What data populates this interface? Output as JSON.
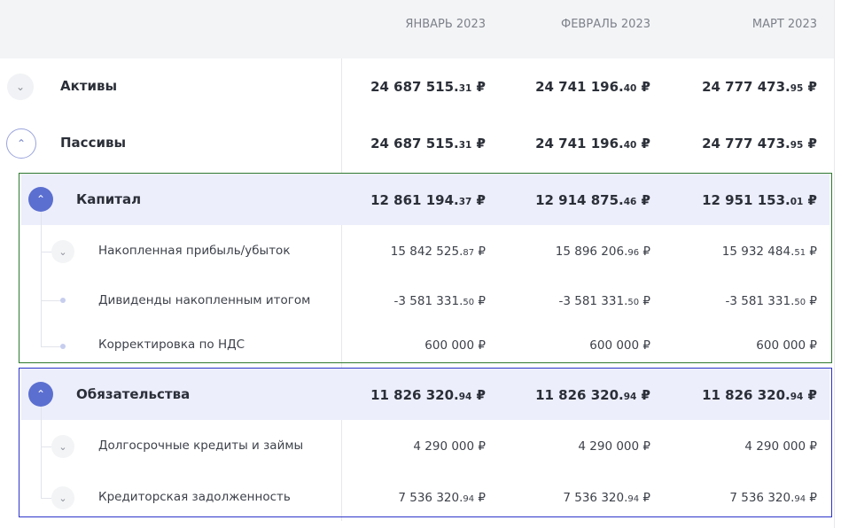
{
  "columns": [
    "ЯНВАРЬ 2023",
    "ФЕВРАЛЬ 2023",
    "МАРТ 2023"
  ],
  "rows": [
    {
      "label": "Активы",
      "values": [
        {
          "int": "24 687 515.",
          "frac": "31",
          "cur": " ₽"
        },
        {
          "int": "24 741 196.",
          "frac": "40",
          "cur": " ₽"
        },
        {
          "int": "24 777 473.",
          "frac": "95",
          "cur": " ₽"
        }
      ]
    },
    {
      "label": "Пассивы",
      "values": [
        {
          "int": "24 687 515.",
          "frac": "31",
          "cur": " ₽"
        },
        {
          "int": "24 741 196.",
          "frac": "40",
          "cur": " ₽"
        },
        {
          "int": "24 777 473.",
          "frac": "95",
          "cur": " ₽"
        }
      ]
    },
    {
      "label": "Капитал",
      "values": [
        {
          "int": "12 861 194.",
          "frac": "37",
          "cur": " ₽"
        },
        {
          "int": "12 914 875.",
          "frac": "46",
          "cur": " ₽"
        },
        {
          "int": "12 951 153.",
          "frac": "01",
          "cur": " ₽"
        }
      ]
    },
    {
      "label": "Накопленная прибыль/убыток",
      "values": [
        {
          "int": "15 842 525.",
          "frac": "87",
          "cur": " ₽"
        },
        {
          "int": "15 896 206.",
          "frac": "96",
          "cur": " ₽"
        },
        {
          "int": "15 932 484.",
          "frac": "51",
          "cur": " ₽"
        }
      ]
    },
    {
      "label": "Дивиденды накопленным итогом",
      "values": [
        {
          "int": "-3 581 331.",
          "frac": "50",
          "cur": " ₽"
        },
        {
          "int": "-3 581 331.",
          "frac": "50",
          "cur": " ₽"
        },
        {
          "int": "-3 581 331.",
          "frac": "50",
          "cur": " ₽"
        }
      ]
    },
    {
      "label": "Корректировка по НДС",
      "values": [
        {
          "int": "600 000",
          "frac": "",
          "cur": " ₽"
        },
        {
          "int": "600 000",
          "frac": "",
          "cur": " ₽"
        },
        {
          "int": "600 000",
          "frac": "",
          "cur": " ₽"
        }
      ]
    },
    {
      "label": "Обязательства",
      "values": [
        {
          "int": "11 826 320.",
          "frac": "94",
          "cur": " ₽"
        },
        {
          "int": "11 826 320.",
          "frac": "94",
          "cur": " ₽"
        },
        {
          "int": "11 826 320.",
          "frac": "94",
          "cur": " ₽"
        }
      ]
    },
    {
      "label": "Долгосрочные кредиты и займы",
      "values": [
        {
          "int": "4 290 000",
          "frac": "",
          "cur": " ₽"
        },
        {
          "int": "4 290 000",
          "frac": "",
          "cur": " ₽"
        },
        {
          "int": "4 290 000",
          "frac": "",
          "cur": " ₽"
        }
      ]
    },
    {
      "label": "Кредиторская задолженность",
      "values": [
        {
          "int": "7 536 320.",
          "frac": "94",
          "cur": " ₽"
        },
        {
          "int": "7 536 320.",
          "frac": "94",
          "cur": " ₽"
        },
        {
          "int": "7 536 320.",
          "frac": "94",
          "cur": " ₽"
        }
      ]
    }
  ],
  "icons": {
    "collapsed": "chevron-down-icon",
    "expanded": "chevron-up-icon",
    "leaf": "dot-icon"
  },
  "colors": {
    "accent": "#5b6fd0",
    "highlight": "#eceefb",
    "green_outline": "#2f7a2f",
    "blue_outline": "#2c35c9"
  }
}
